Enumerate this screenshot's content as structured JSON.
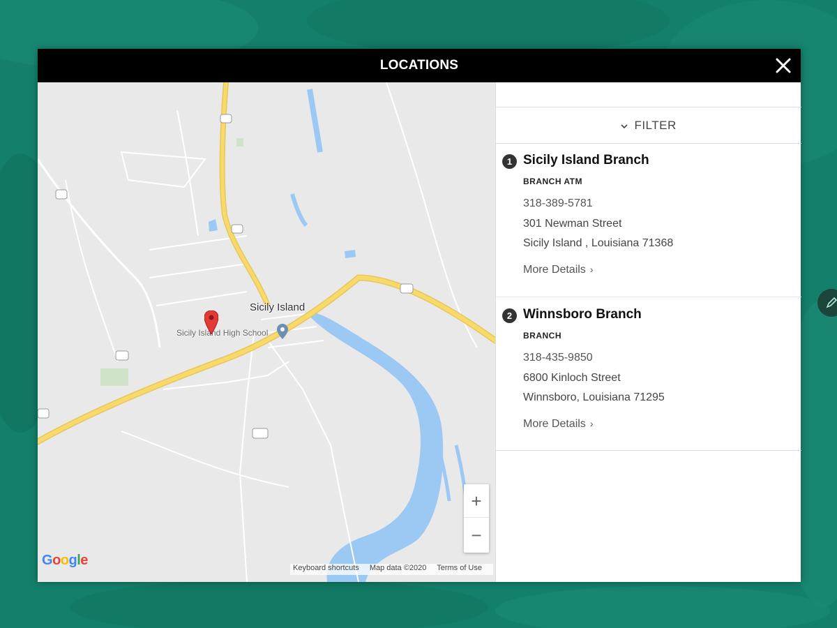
{
  "background": {
    "color": "#14806b"
  },
  "modal": {
    "title": "LOCATIONS",
    "close_symbol": "✕"
  },
  "map": {
    "town_label": "Sicily Island",
    "school_label": "Sicily Island High School",
    "marker_color": "#e53935",
    "water_color": "#9cc9f3",
    "road_color": "#f8d96b",
    "zoom_in": "+",
    "zoom_out": "−",
    "google_logo": "Google",
    "footer": {
      "shortcuts": "Keyboard shortcuts",
      "map_data": "Map data ©2020",
      "terms": "Terms of Use"
    }
  },
  "panel": {
    "filter_label": "FILTER",
    "filter_icon": "chevron-down-icon",
    "locations": [
      {
        "number": "1",
        "name": "Sicily Island Branch",
        "type": "BRANCH ATM",
        "phone": "318-389-5781",
        "street": "301 Newman Street",
        "city": "Sicily Island , Louisiana 71368",
        "more": "More Details"
      },
      {
        "number": "2",
        "name": "Winnsboro Branch",
        "type": "BRANCH",
        "phone": "318-435-9850",
        "street": "6800 Kinloch Street",
        "city": "Winnsboro, Louisiana 71295",
        "more": "More Details"
      }
    ]
  }
}
